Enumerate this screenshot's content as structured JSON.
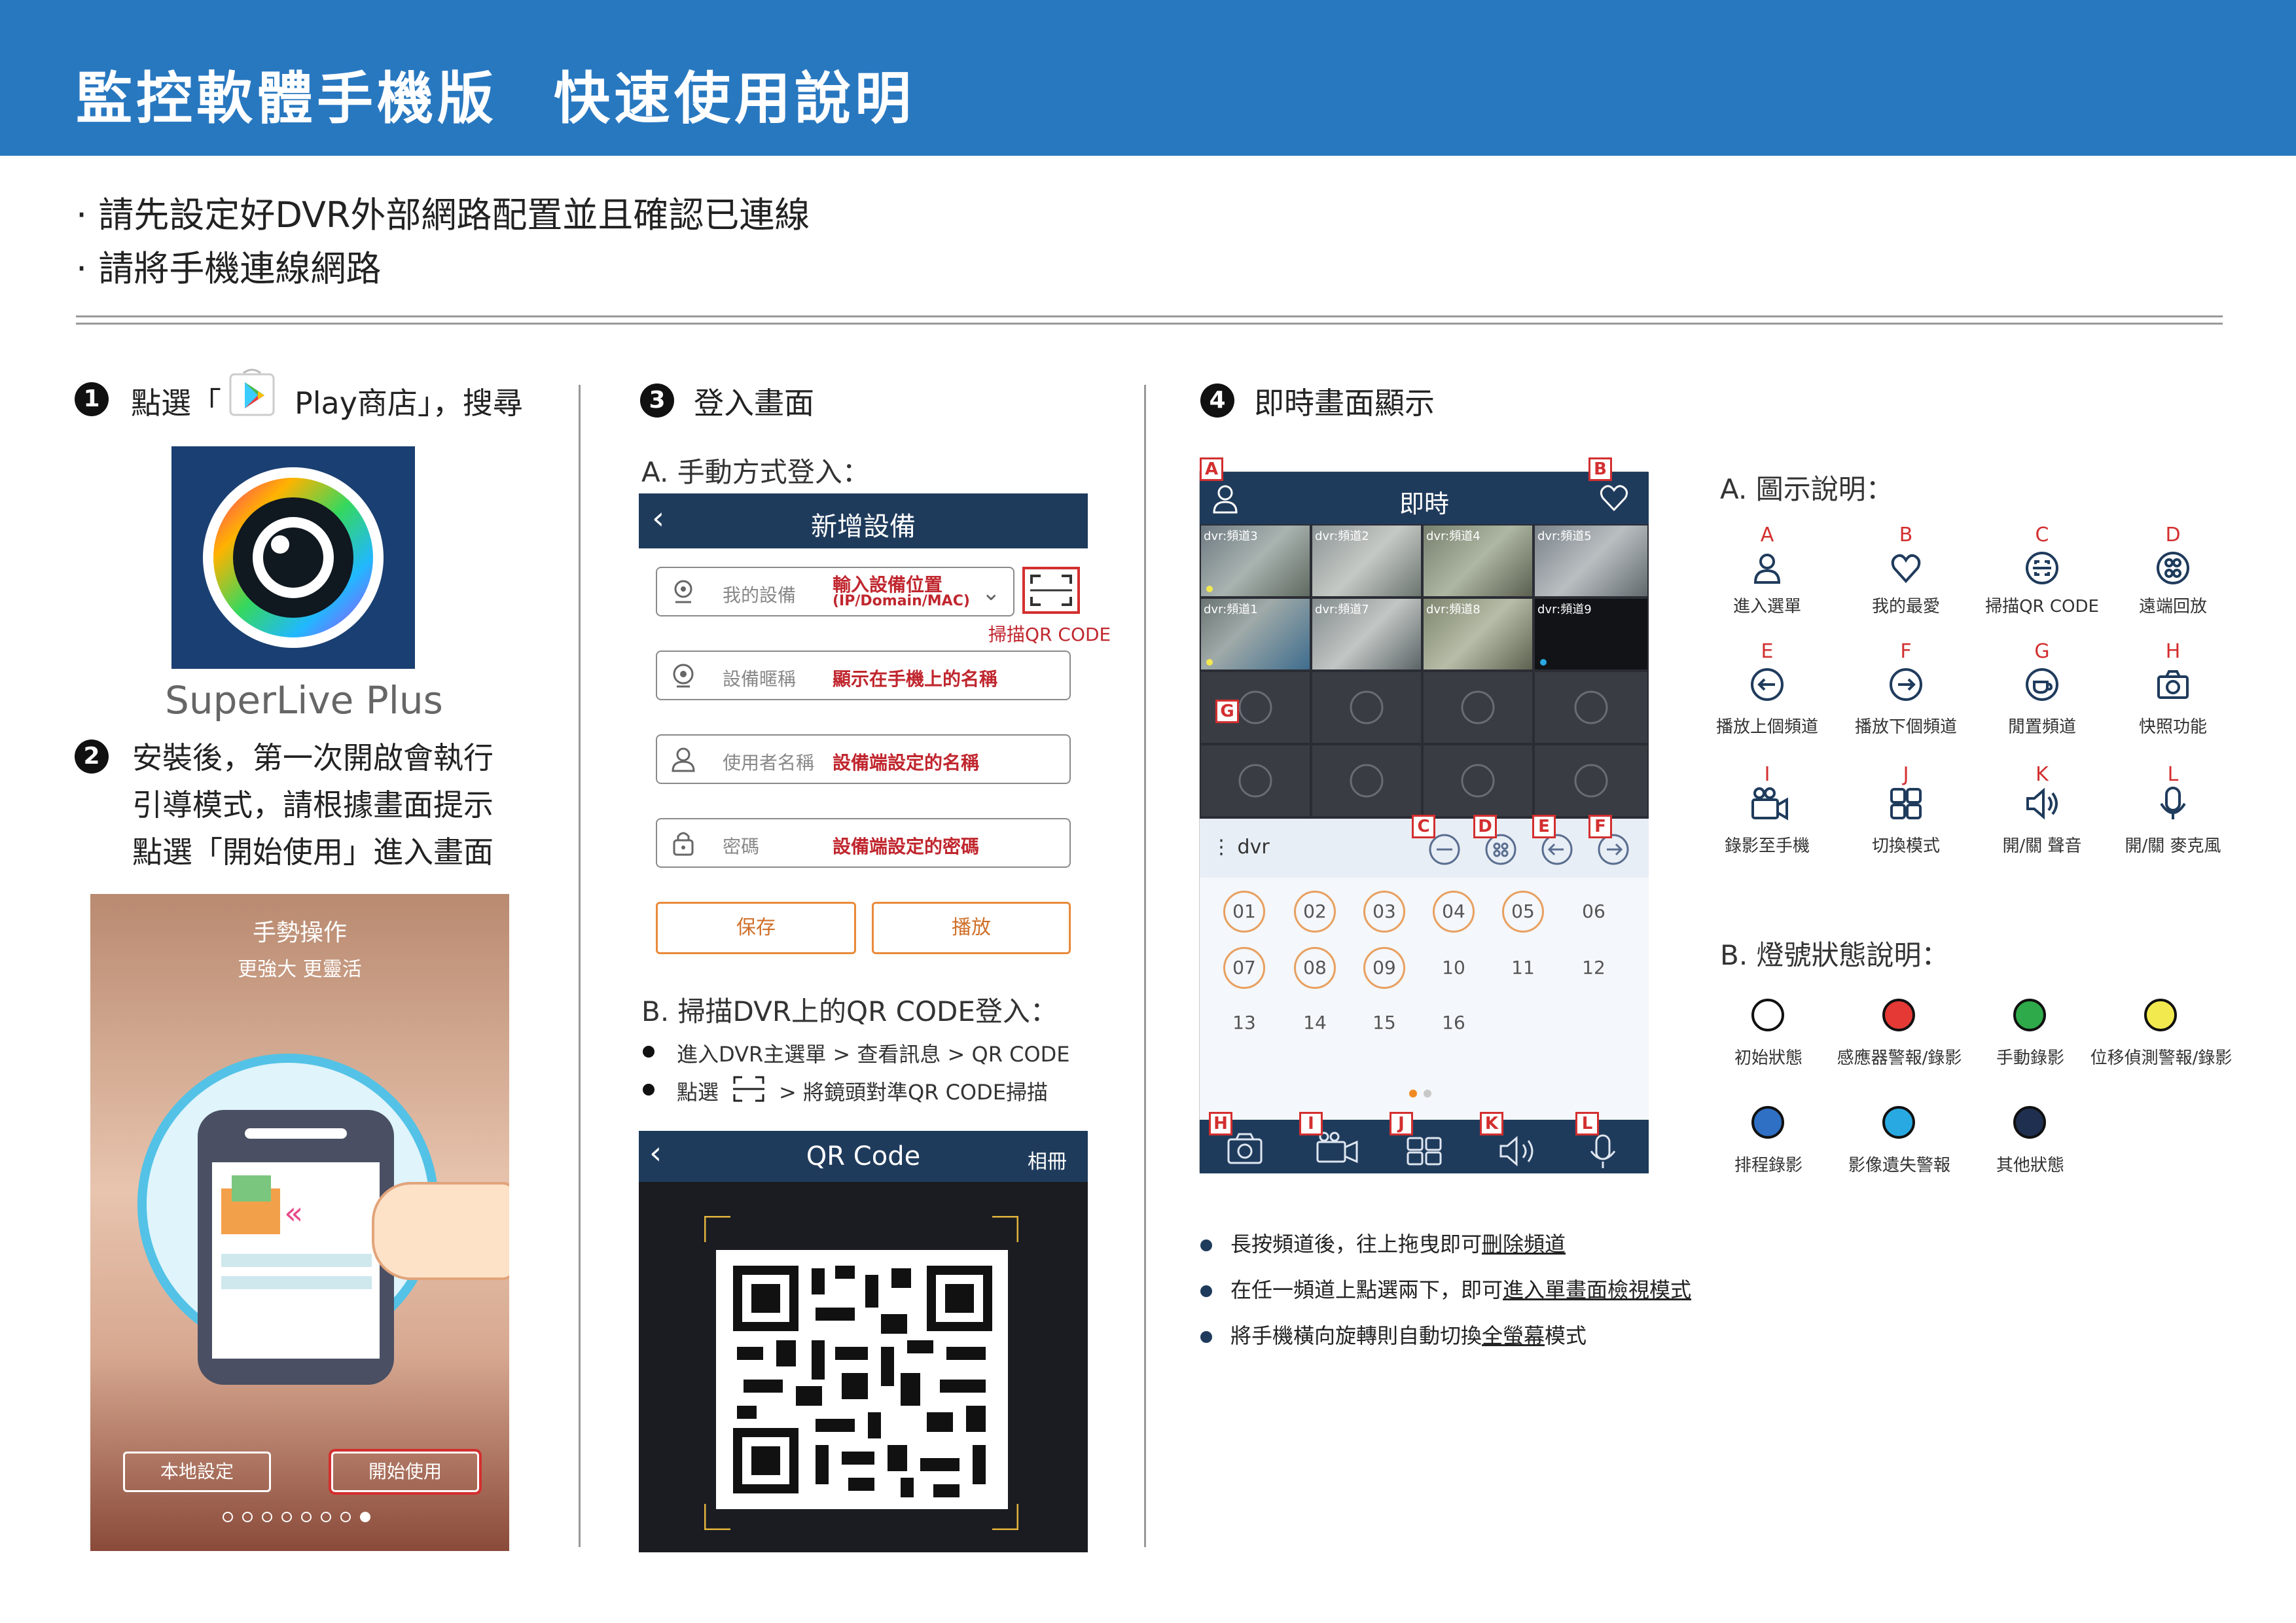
{
  "header": {
    "title_left": "監控軟體手機版",
    "title_right": "快速使用說明"
  },
  "intro": [
    "· 請先設定好DVR外部網路配置並且確認已連線",
    "· 請將手機連線網路"
  ],
  "step1": {
    "num": "1",
    "pre": "點選「",
    "store": "Play商店」，搜尋",
    "app_name": "SuperLive Plus"
  },
  "step2": {
    "num": "2",
    "lines": [
      "安裝後，第一次開啟會執行",
      "引導模式，請根據畫面提示",
      "點選「開始使用」進入畫面"
    ]
  },
  "guide_screen": {
    "title": "手勢操作",
    "subtitle": "更強大 更靈活",
    "btn_local": "本地設定",
    "btn_start": "開始使用"
  },
  "step3": {
    "num": "3",
    "title": "登入畫面",
    "sub_a": "A. 手動方式登入：",
    "add_device": {
      "title": "新增設備",
      "device_ph": "我的設備",
      "device_hint": "輸入設備位置",
      "device_hint2": "(IP/Domain/MAC)",
      "scan_label": "掃描QR CODE",
      "nick_ph": "設備暱稱",
      "nick_hint": "顯示在手機上的名稱",
      "user_ph": "使用者名稱",
      "user_hint": "設備端設定的名稱",
      "pwd_ph": "密碼",
      "pwd_hint": "設備端設定的密碼",
      "save": "保存",
      "play": "播放"
    },
    "sub_b": "B. 掃描DVR上的QR CODE登入：",
    "b1": "進入DVR主選單 > 查看訊息 > QR CODE",
    "b2_pre": "點選",
    "b2_post": "> 將鏡頭對準QR CODE掃描",
    "qr_screen": {
      "title": "QR Code",
      "album": "相冊"
    }
  },
  "step4": {
    "num": "4",
    "title": "即時畫面顯示",
    "live": {
      "title": "即時",
      "channels": [
        "dvr:頻道3",
        "dvr:頻道2",
        "dvr:頻道4",
        "dvr:頻道5",
        "dvr:頻道1",
        "dvr:頻道7",
        "dvr:頻道8",
        "dvr:頻道9"
      ],
      "device": "dvr",
      "circled_numbers": [
        "01",
        "02",
        "03",
        "04",
        "05",
        "07",
        "08",
        "09"
      ],
      "plain_numbers": [
        "06",
        "10",
        "11",
        "12",
        "13",
        "14",
        "15",
        "16"
      ]
    },
    "tags": [
      "A",
      "B",
      "C",
      "D",
      "E",
      "F",
      "G",
      "H",
      "I",
      "J",
      "K",
      "L"
    ],
    "notes": [
      {
        "pre": "長按頻道後，往上拖曳即可",
        "u": "刪除頻道",
        "post": ""
      },
      {
        "pre": "在任一頻道上點選兩下，即可",
        "u": "進入單畫面檢視模式",
        "post": ""
      },
      {
        "pre": "將手機橫向旋轉則自動切換",
        "u": "全螢幕",
        "post": "模式"
      }
    ],
    "legend_title": "A. 圖示說明：",
    "icons": [
      {
        "letter": "A",
        "label": "進入選單",
        "icon": "person-icon"
      },
      {
        "letter": "B",
        "label": "我的最愛",
        "icon": "heart-icon"
      },
      {
        "letter": "C",
        "label": "掃描QR CODE",
        "icon": "scan-icon"
      },
      {
        "letter": "D",
        "label": "遠端回放",
        "icon": "film-reel-icon"
      },
      {
        "letter": "E",
        "label": "播放上個頻道",
        "icon": "arrow-left-icon"
      },
      {
        "letter": "F",
        "label": "播放下個頻道",
        "icon": "arrow-right-icon"
      },
      {
        "letter": "G",
        "label": "閒置頻道",
        "icon": "cup-icon"
      },
      {
        "letter": "H",
        "label": "快照功能",
        "icon": "camera-icon"
      },
      {
        "letter": "I",
        "label": "錄影至手機",
        "icon": "video-camera-icon"
      },
      {
        "letter": "J",
        "label": "切換模式",
        "icon": "grid-icon"
      },
      {
        "letter": "K",
        "label": "開/關 聲音",
        "icon": "speaker-icon"
      },
      {
        "letter": "L",
        "label": "開/關 麥克風",
        "icon": "microphone-icon"
      }
    ],
    "status_title": "B. 燈號狀態說明：",
    "status": [
      {
        "label": "初始狀態",
        "color": "#ffffff"
      },
      {
        "label": "感應器警報/錄影",
        "color": "#e53935"
      },
      {
        "label": "手動錄影",
        "color": "#2eaa4a"
      },
      {
        "label": "位移偵測警報/錄影",
        "color": "#f2e94e"
      },
      {
        "label": "排程錄影",
        "color": "#2f6fc4"
      },
      {
        "label": "影像遺失警報",
        "color": "#29a9e1"
      },
      {
        "label": "其他狀態",
        "color": "#1f2f4f"
      }
    ]
  }
}
